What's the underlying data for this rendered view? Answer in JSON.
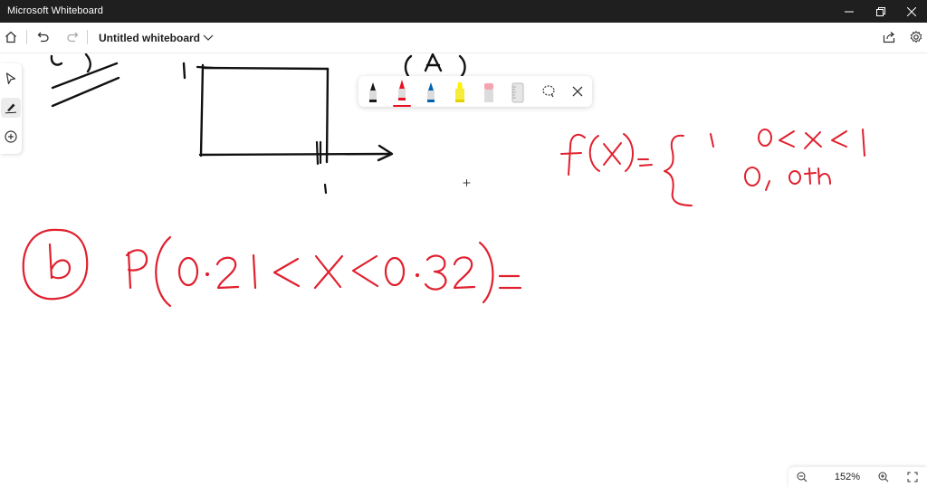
{
  "window": {
    "app_title": "Microsoft Whiteboard"
  },
  "toolbar": {
    "board_title": "Untitled whiteboard",
    "icons": [
      "home-icon",
      "undo-icon",
      "redo-icon",
      "share-icon",
      "settings-icon"
    ]
  },
  "left_rail": {
    "tools": [
      "select-icon",
      "inking-icon",
      "add-icon"
    ],
    "active_tool": "inking-icon"
  },
  "pen_tray": {
    "tools": [
      {
        "name": "black-pen",
        "color": "#1a1a1a"
      },
      {
        "name": "red-pen",
        "color": "#e81123",
        "selected": true
      },
      {
        "name": "blue-pen",
        "color": "#0063b1"
      },
      {
        "name": "yellow-highlighter",
        "color": "#fff100"
      },
      {
        "name": "eraser",
        "color": "#f4a6b0"
      },
      {
        "name": "ruler",
        "color": "#d9d9d9"
      },
      {
        "name": "lasso-select",
        "color": "#333333"
      }
    ]
  },
  "zoom": {
    "level": "152%"
  },
  "ink_colors": {
    "black": "#111111",
    "red": "#e0202e"
  }
}
